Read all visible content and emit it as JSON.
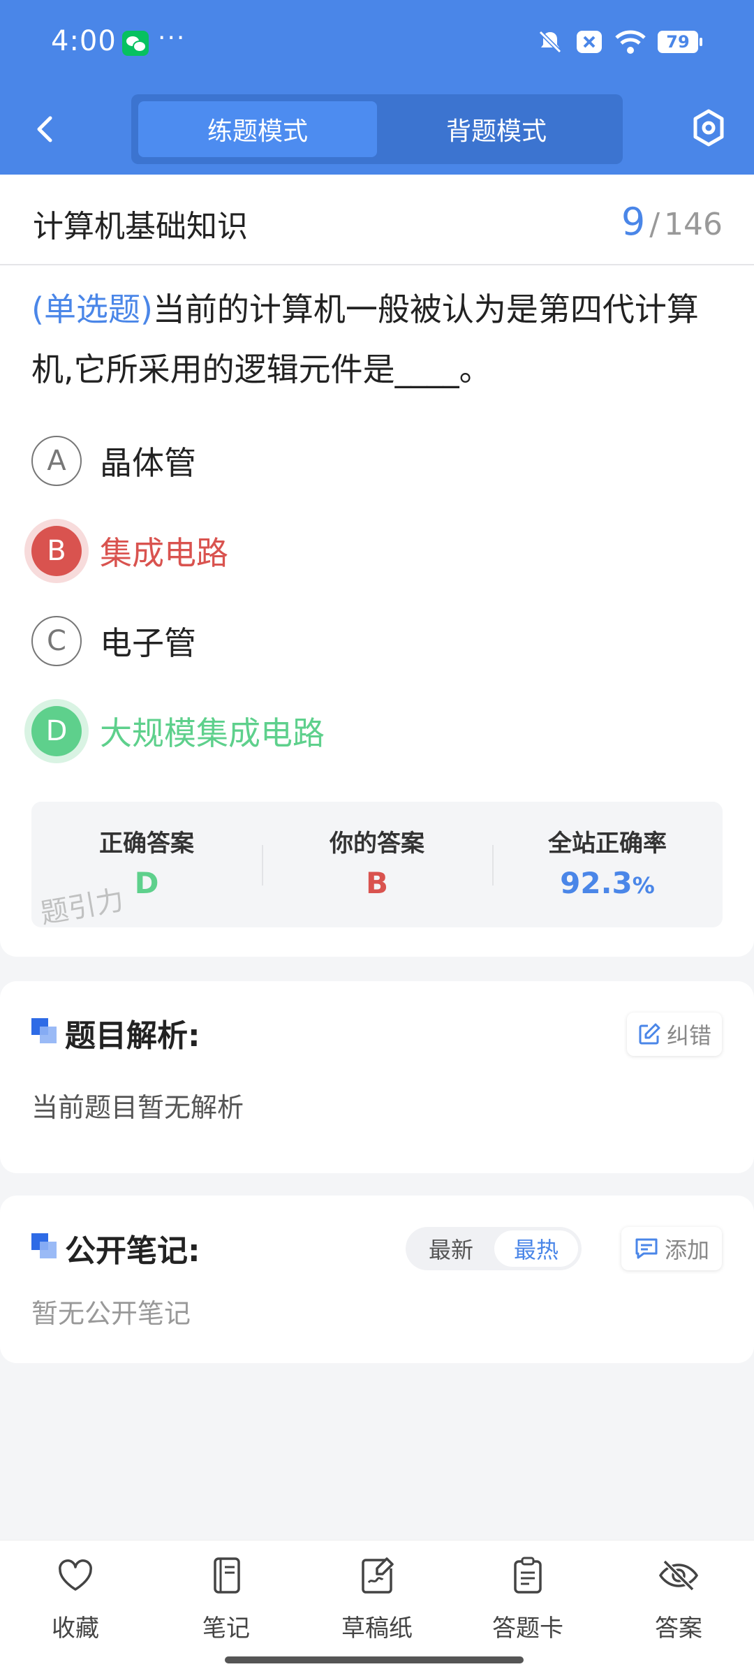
{
  "status_bar": {
    "time": "4:00",
    "more": "···",
    "battery": "79"
  },
  "header": {
    "modes": [
      {
        "label": "练题模式",
        "active": true
      },
      {
        "label": "背题模式",
        "active": false
      }
    ]
  },
  "section": {
    "title": "计算机基础知识",
    "current": "9",
    "total": "146",
    "separator": "/"
  },
  "question": {
    "type_label": "(单选题)",
    "text": "当前的计算机一般被认为是第四代计算机,它所采用的逻辑元件是____。",
    "options": [
      {
        "letter": "A",
        "text": "晶体管",
        "state": "normal"
      },
      {
        "letter": "B",
        "text": "集成电路",
        "state": "wrong"
      },
      {
        "letter": "C",
        "text": "电子管",
        "state": "normal"
      },
      {
        "letter": "D",
        "text": "大规模集成电路",
        "state": "correct"
      }
    ]
  },
  "result": {
    "correct_label": "正确答案",
    "correct_value": "D",
    "yours_label": "你的答案",
    "yours_value": "B",
    "rate_label": "全站正确率",
    "rate_value": "92.3",
    "rate_unit": "%",
    "watermark": "题引力"
  },
  "analysis": {
    "heading": "题目解析:",
    "correct_error_label": "纠错",
    "body": "当前题目暂无解析"
  },
  "notes": {
    "heading": "公开笔记:",
    "sort_newest": "最新",
    "sort_hottest": "最热",
    "add_label": "添加",
    "empty": "暂无公开笔记"
  },
  "bottom_nav": [
    {
      "label": "收藏",
      "icon": "heart-icon"
    },
    {
      "label": "笔记",
      "icon": "notebook-icon"
    },
    {
      "label": "草稿纸",
      "icon": "draft-paper-icon"
    },
    {
      "label": "答题卡",
      "icon": "answer-sheet-icon"
    },
    {
      "label": "答案",
      "icon": "eye-off-icon"
    }
  ],
  "colors": {
    "primary": "#4a86e8",
    "wrong": "#d9534f",
    "correct": "#5ed08c"
  }
}
